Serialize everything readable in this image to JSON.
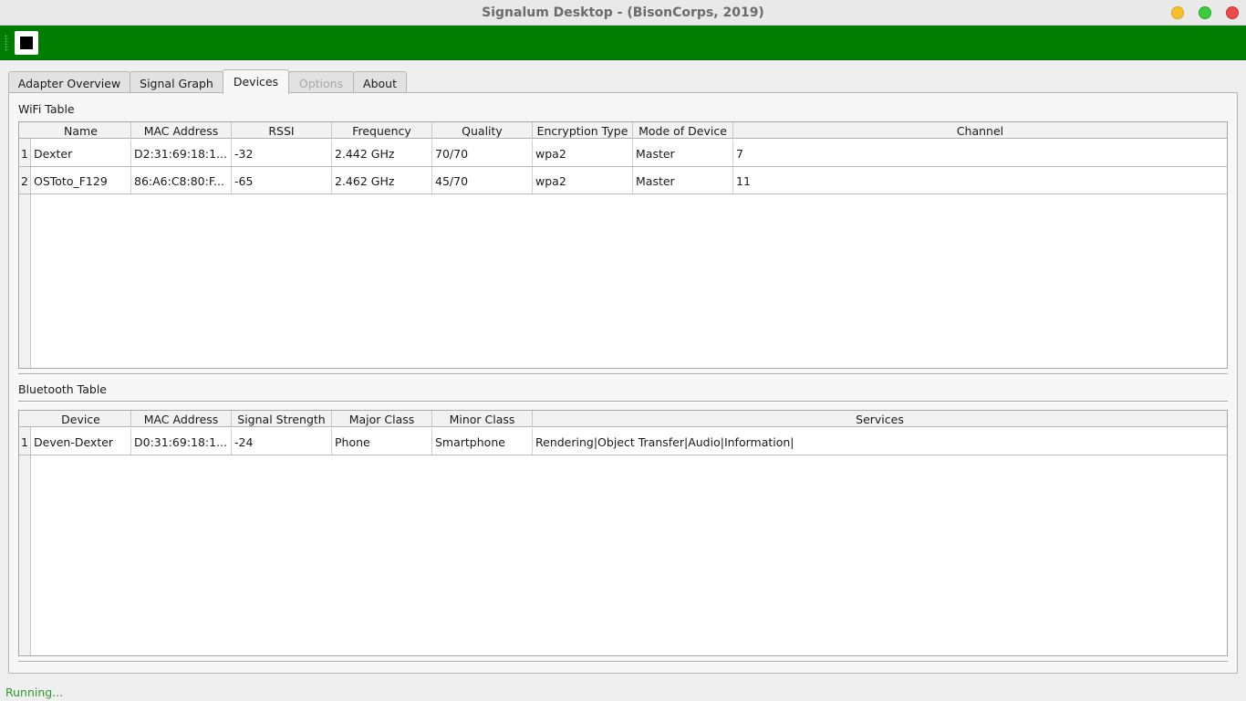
{
  "window": {
    "title": "Signalum Desktop - (BisonCorps, 2019)"
  },
  "toolbar": {
    "stop_button": "stop-icon"
  },
  "tabs": [
    {
      "label": "Adapter Overview",
      "state": "normal"
    },
    {
      "label": "Signal Graph",
      "state": "normal"
    },
    {
      "label": "Devices",
      "state": "active"
    },
    {
      "label": "Options",
      "state": "disabled"
    },
    {
      "label": "About",
      "state": "normal"
    }
  ],
  "wifi": {
    "title": "WiFi Table",
    "headers": [
      "Name",
      "MAC Address",
      "RSSI",
      "Frequency",
      "Quality",
      "Encryption Type",
      "Mode of Device",
      "Channel"
    ],
    "rows": [
      {
        "num": "1",
        "cells": [
          "Dexter",
          "D2:31:69:18:1...",
          "-32",
          "2.442 GHz",
          "70/70",
          "wpa2",
          "Master",
          "7"
        ]
      },
      {
        "num": "2",
        "cells": [
          "OSToto_F129",
          "86:A6:C8:80:F...",
          "-65",
          "2.462 GHz",
          "45/70",
          "wpa2",
          "Master",
          "11"
        ]
      }
    ]
  },
  "bluetooth": {
    "title": "Bluetooth Table",
    "headers": [
      "Device",
      "MAC Address",
      "Signal Strength",
      "Major Class",
      "Minor Class",
      "Services"
    ],
    "rows": [
      {
        "num": "1",
        "cells": [
          "Deven-Dexter",
          "D0:31:69:18:1...",
          "-24",
          "Phone",
          "Smartphone",
          "Rendering|Object Transfer|Audio|Information|"
        ]
      }
    ]
  },
  "status": {
    "text": "Running..."
  },
  "colors": {
    "toolbar": "#007d00",
    "status_text": "#2e9a2e"
  }
}
